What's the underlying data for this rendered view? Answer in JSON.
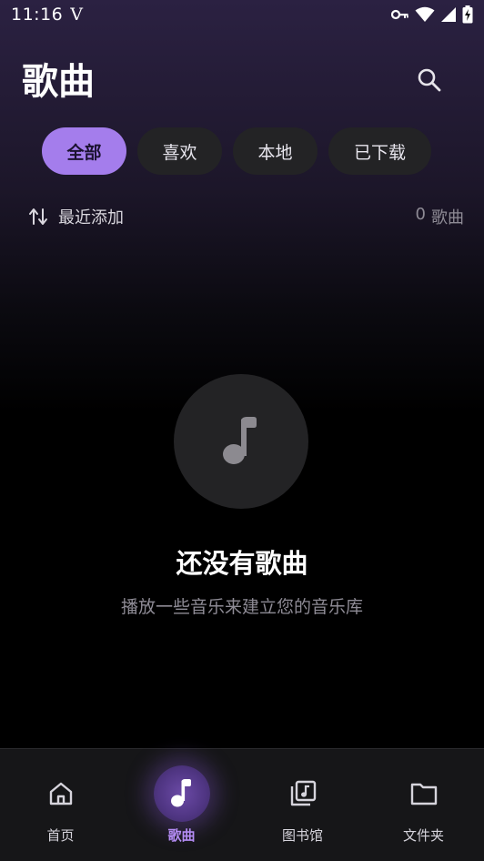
{
  "status_bar": {
    "time": "11:16",
    "carrier_glyph": "V",
    "icons": [
      "key-icon",
      "wifi-icon",
      "signal-icon",
      "battery-charging-icon"
    ]
  },
  "header": {
    "title": "歌曲",
    "search_icon": "search-icon"
  },
  "filters": {
    "all": "全部",
    "favorites": "喜欢",
    "local": "本地",
    "downloaded": "已下载",
    "selected": "全部"
  },
  "sort": {
    "icon": "sort-arrows-icon",
    "label": "最近添加",
    "count": "0",
    "count_unit": "歌曲"
  },
  "empty_state": {
    "icon": "music-note-icon",
    "title": "还没有歌曲",
    "subtitle": "播放一些音乐来建立您的音乐库"
  },
  "bottom_nav": {
    "home": "首页",
    "songs": "歌曲",
    "library": "图书馆",
    "folders": "文件夹",
    "active": "歌曲"
  },
  "colors": {
    "accent": "#a47dec",
    "active_nav_label": "#b48cf4",
    "chip_bg": "#232325",
    "nav_bg": "#161618"
  }
}
